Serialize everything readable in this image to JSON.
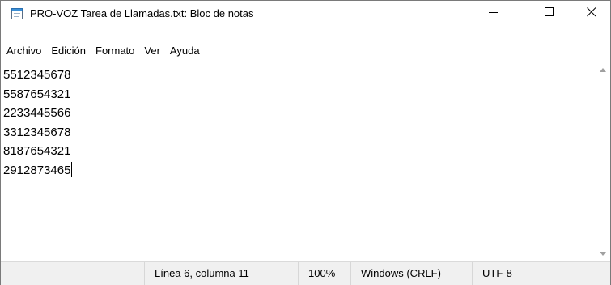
{
  "window": {
    "title": "PRO-VOZ Tarea de Llamadas.txt: Bloc de notas",
    "icon": "notepad-icon",
    "controls": {
      "minimize_icon": "minimize-icon",
      "maximize_icon": "maximize-icon",
      "close_icon": "close-icon"
    }
  },
  "menu": {
    "items": [
      "Archivo",
      "Edición",
      "Formato",
      "Ver",
      "Ayuda"
    ]
  },
  "editor": {
    "lines": [
      "5512345678",
      "5587654321",
      "2233445566",
      "3312345678",
      "8187654321",
      "2912873465"
    ]
  },
  "statusbar": {
    "position": "Línea 6, columna 11",
    "zoom": "100%",
    "line_ending": "Windows (CRLF)",
    "encoding": "UTF-8"
  },
  "colors": {
    "status_bg": "#f0f0f0",
    "icon_blue": "#3b8fd6"
  }
}
